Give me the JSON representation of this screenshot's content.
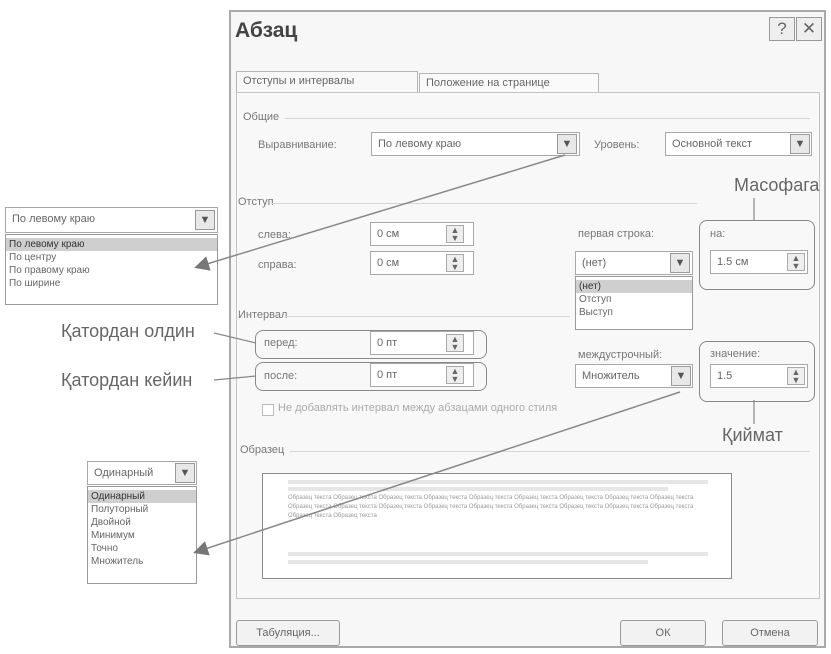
{
  "dialog": {
    "title": "Абзац",
    "help_label": "?",
    "close_label": "✕",
    "tabs": [
      "Отступы и интервалы",
      "Положение на странице"
    ],
    "general": {
      "heading": "Общие",
      "alignment_label": "Выравнивание:",
      "alignment_value": "По левому краю",
      "level_label": "Уровень:",
      "level_value": "Основной текст"
    },
    "indent": {
      "heading": "Отступ",
      "left_label": "слева:",
      "left_value": "0 см",
      "right_label": "справа:",
      "right_value": "0 см",
      "first_line_label": "первая строка:",
      "first_line_value": "(нет)",
      "first_line_options": [
        "(нет)",
        "Отступ",
        "Выступ"
      ],
      "on_label": "на:",
      "on_value": "1.5 см"
    },
    "spacing": {
      "heading": "Интервал",
      "before_label": "перед:",
      "before_value": "0 пт",
      "after_label": "после:",
      "after_value": "0 пт",
      "line_label": "междустрочный:",
      "line_value": "Множитель",
      "value_label": "значение:",
      "value_value": "1.5",
      "checkbox_label": "Не добавлять интервал между абзацами одного стиля"
    },
    "sample": {
      "heading": "Образец",
      "text": "Образец текста Образец текста Образец текста Образец текста Образец текста Образец текста Образец текста Образец текста Образец текста Образец текста Образец текста Образец текста Образец текста Образец текста Образец текста Образец текста Образец текста Образец текста Образец текста Образец текста"
    },
    "buttons": {
      "tabs": "Табуляция...",
      "ok": "ОК",
      "cancel": "Отмена"
    }
  },
  "left_alignment_dropdown": {
    "value": "По левому краю",
    "options": [
      "По левому краю",
      "По центру",
      "По правому краю",
      "По ширине"
    ]
  },
  "line_spacing_dropdown": {
    "value": "Одинарный",
    "options": [
      "Одинарный",
      "Полуторный",
      "Двойной",
      "Минимум",
      "Точно",
      "Множитель"
    ]
  },
  "annotations": {
    "before": "Қатордан олдин",
    "after": "Қатордан кейин",
    "distance": "Масофага",
    "value": "Қиймат"
  }
}
